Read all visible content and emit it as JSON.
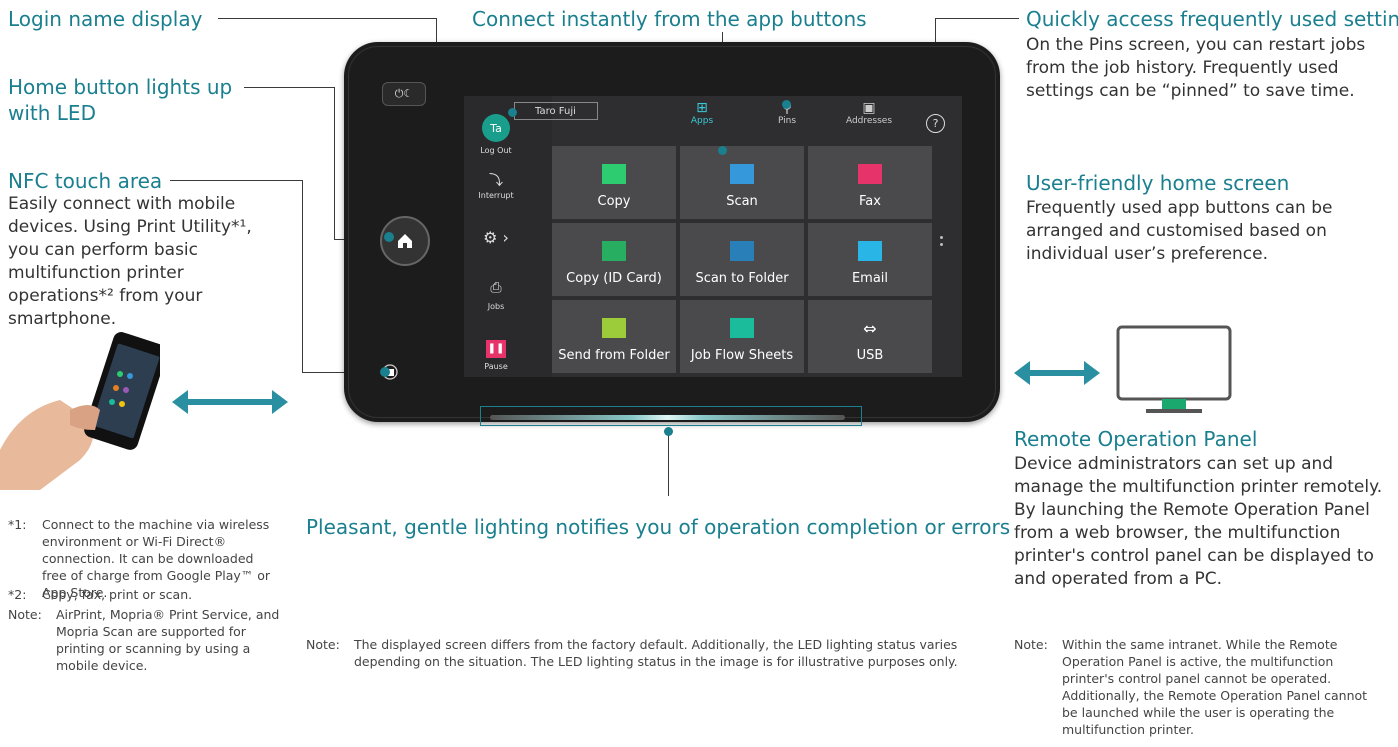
{
  "callouts": {
    "login_name": "Login name display",
    "connect_instantly": "Connect instantly from the app buttons",
    "quick_access_title": "Quickly access frequently used settings",
    "quick_access_body": "On the Pins screen, you can restart jobs from the job history. Frequently used settings can be “pinned” to save time.",
    "home_button_line1": "Home button lights up",
    "home_button_line2": "with LED",
    "nfc_title": "NFC touch area",
    "nfc_body": "Easily connect with mobile devices. Using Print Utility*¹, you can perform basic multifunction printer operations*² from your smartphone.",
    "user_friendly_title": "User-friendly home screen",
    "user_friendly_body": "Frequently used app buttons can be arranged and customised based on individual user’s preference.",
    "pleasant_lighting": "Pleasant, gentle lighting notifies you of operation completion or errors",
    "remote_title": "Remote Operation Panel",
    "remote_body": "Device administrators can set up and manage the multifunction printer remotely. By launching the Remote Operation Panel from a web browser, the multifunction printer's control panel can be displayed to and operated from a PC."
  },
  "footnotes": {
    "fn1_label": "*1:",
    "fn1_text": "Connect to the machine via wireless environment or Wi-Fi Direct® connection. It can be downloaded free of charge from Google Play™ or App Store.",
    "fn2_label": "*2:",
    "fn2_text": "Copy, fax, print or scan.",
    "note_left_label": "Note:",
    "note_left_text": "AirPrint, Mopria® Print Service, and Mopria Scan are supported for printing or scanning by using a mobile device.",
    "note_center_label": "Note:",
    "note_center_text": "The displayed screen differs from the factory default. Additionally, the LED lighting status varies depending on the situation. The LED lighting status in the image is for illustrative purposes only.",
    "note_right_label": "Note:",
    "note_right_text": "Within the same intranet. While the Remote Operation Panel is active, the multifunction printer's control panel cannot be operated. Additionally, the Remote Operation Panel cannot be launched while the user is operating the multifunction printer."
  },
  "screen": {
    "user_name": "Taro Fuji",
    "avatar_initials": "Ta",
    "logout": "Log Out",
    "interrupt": "Interrupt",
    "jobs": "Jobs",
    "pause": "Pause",
    "tabs": [
      "Apps",
      "Pins",
      "Addresses"
    ],
    "help": "?",
    "tiles": [
      "Copy",
      "Scan",
      "Fax",
      "Copy (ID Card)",
      "Scan to Folder",
      "Email",
      "Send from Folder",
      "Job Flow Sheets",
      "USB"
    ]
  },
  "colors": {
    "accent": "#1a7f8e",
    "screen_bg": "#2e2e30",
    "tile_bg": "#4a4a4d",
    "avatar": "#1a9e8c"
  }
}
